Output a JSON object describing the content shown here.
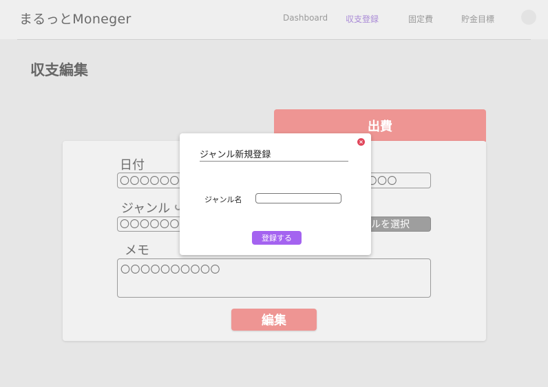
{
  "header": {
    "brand": "まるっとMoneger",
    "nav": [
      {
        "label": "Dashboard",
        "active": false
      },
      {
        "label": "収支登録",
        "active": true
      },
      {
        "label": "固定費",
        "active": false
      },
      {
        "label": "貯金目標",
        "active": false
      }
    ]
  },
  "page": {
    "title": "収支編集",
    "type_tab": "出費",
    "date_label": "日付",
    "date_value": "〇〇〇〇〇〇〇",
    "date_value_right": "〇〇〇",
    "genre_label": "ジャンル",
    "genre_value": "〇〇〇〇〇〇〇",
    "genre_select_label": "ルを選択",
    "memo_label": "メモ",
    "memo_value": "〇〇〇〇〇〇〇〇〇〇",
    "edit_button": "編集"
  },
  "modal": {
    "title": "ジャンル新規登録",
    "close": "×",
    "field_label": "ジャンル名",
    "field_value": "",
    "submit": "登録する"
  },
  "colors": {
    "accent_pink": "#ee9593",
    "accent_purple": "#a463f0",
    "nav_active": "#a98ad6",
    "close_red": "#e0455a"
  }
}
